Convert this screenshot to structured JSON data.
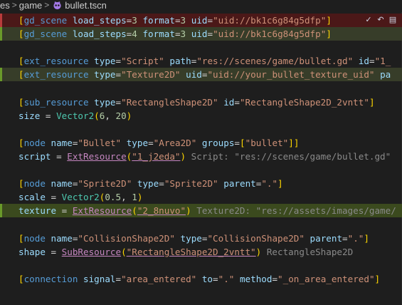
{
  "breadcrumb": {
    "items": [
      "es",
      "game",
      "bullet.tscn"
    ]
  },
  "actions": [
    "accept-check-icon",
    "undo-icon",
    "file-icon"
  ],
  "colors": {
    "background": "#1e1e1e",
    "removed_line": "#4b1818",
    "added_line": "#373d29"
  },
  "lines": [
    {
      "kind": "removed",
      "segments": [
        [
          "br",
          "["
        ],
        [
          "tag",
          "gd_scene "
        ],
        [
          "prop",
          "load_steps"
        ],
        [
          "pl",
          "="
        ],
        [
          "num",
          "3"
        ],
        [
          "pl",
          " "
        ],
        [
          "prop",
          "format"
        ],
        [
          "pl",
          "="
        ],
        [
          "num",
          "3"
        ],
        [
          "pl",
          " "
        ],
        [
          "prop",
          "uid"
        ],
        [
          "pl",
          "="
        ],
        [
          "str",
          "\"uid://bk1c6g84g5dfp\""
        ],
        [
          "br",
          "]"
        ]
      ]
    },
    {
      "kind": "added",
      "segments": [
        [
          "br",
          "["
        ],
        [
          "tag",
          "gd_scene "
        ],
        [
          "prop",
          "load_steps"
        ],
        [
          "pl",
          "="
        ],
        [
          "num",
          "4"
        ],
        [
          "pl",
          " "
        ],
        [
          "prop",
          "format"
        ],
        [
          "pl",
          "="
        ],
        [
          "num",
          "3"
        ],
        [
          "pl",
          " "
        ],
        [
          "prop",
          "uid"
        ],
        [
          "pl",
          "="
        ],
        [
          "str",
          "\"uid://bk1c6g84g5dfp\""
        ],
        [
          "br",
          "]"
        ]
      ]
    },
    {
      "kind": "blank",
      "segments": []
    },
    {
      "kind": "normal",
      "segments": [
        [
          "br",
          "["
        ],
        [
          "tag",
          "ext_resource "
        ],
        [
          "prop",
          "type"
        ],
        [
          "pl",
          "="
        ],
        [
          "str",
          "\"Script\""
        ],
        [
          "pl",
          " "
        ],
        [
          "prop",
          "path"
        ],
        [
          "pl",
          "="
        ],
        [
          "str",
          "\"res://scenes/game/bullet.gd\""
        ],
        [
          "pl",
          " "
        ],
        [
          "prop",
          "id"
        ],
        [
          "pl",
          "="
        ],
        [
          "str",
          "\"1_"
        ]
      ]
    },
    {
      "kind": "added",
      "segments": [
        [
          "br",
          "["
        ],
        [
          "tag",
          "ext_resource "
        ],
        [
          "prop",
          "type"
        ],
        [
          "pl",
          "="
        ],
        [
          "str",
          "\"Texture2D\""
        ],
        [
          "pl",
          " "
        ],
        [
          "prop",
          "uid"
        ],
        [
          "pl",
          "="
        ],
        [
          "str",
          "\"uid://your_bullet_texture_uid\""
        ],
        [
          "pl",
          " "
        ],
        [
          "prop",
          "pa"
        ]
      ]
    },
    {
      "kind": "blank",
      "segments": []
    },
    {
      "kind": "normal",
      "segments": [
        [
          "br",
          "["
        ],
        [
          "tag",
          "sub_resource "
        ],
        [
          "prop",
          "type"
        ],
        [
          "pl",
          "="
        ],
        [
          "str",
          "\"RectangleShape2D\""
        ],
        [
          "pl",
          " "
        ],
        [
          "prop",
          "id"
        ],
        [
          "pl",
          "="
        ],
        [
          "str",
          "\"RectangleShape2D_2vntt\""
        ],
        [
          "br",
          "]"
        ]
      ]
    },
    {
      "kind": "normal",
      "segments": [
        [
          "prop",
          "size"
        ],
        [
          "pl",
          " = "
        ],
        [
          "fn",
          "Vector2"
        ],
        [
          "br",
          "("
        ],
        [
          "num",
          "6"
        ],
        [
          "pl",
          ", "
        ],
        [
          "num",
          "20"
        ],
        [
          "br",
          ")"
        ]
      ]
    },
    {
      "kind": "blank",
      "segments": []
    },
    {
      "kind": "normal",
      "segments": [
        [
          "br",
          "["
        ],
        [
          "tag",
          "node "
        ],
        [
          "prop",
          "name"
        ],
        [
          "pl",
          "="
        ],
        [
          "str",
          "\"Bullet\""
        ],
        [
          "pl",
          " "
        ],
        [
          "prop",
          "type"
        ],
        [
          "pl",
          "="
        ],
        [
          "str",
          "\"Area2D\""
        ],
        [
          "pl",
          " "
        ],
        [
          "prop",
          "groups"
        ],
        [
          "pl",
          "="
        ],
        [
          "br",
          "["
        ],
        [
          "str",
          "\"bullet\""
        ],
        [
          "br",
          "]]"
        ]
      ]
    },
    {
      "kind": "normal",
      "segments": [
        [
          "prop",
          "script"
        ],
        [
          "pl",
          " = "
        ],
        [
          "extu",
          "ExtResource"
        ],
        [
          "br",
          "("
        ],
        [
          "stru",
          "\"1_j2eda\""
        ],
        [
          "br",
          ")"
        ],
        [
          "hint",
          " Script: \"res://scenes/game/bullet.gd\""
        ]
      ]
    },
    {
      "kind": "blank",
      "segments": []
    },
    {
      "kind": "normal",
      "segments": [
        [
          "br",
          "["
        ],
        [
          "tag",
          "node "
        ],
        [
          "prop",
          "name"
        ],
        [
          "pl",
          "="
        ],
        [
          "str",
          "\"Sprite2D\""
        ],
        [
          "pl",
          " "
        ],
        [
          "prop",
          "type"
        ],
        [
          "pl",
          "="
        ],
        [
          "str",
          "\"Sprite2D\""
        ],
        [
          "pl",
          " "
        ],
        [
          "prop",
          "parent"
        ],
        [
          "pl",
          "="
        ],
        [
          "str",
          "\".\""
        ],
        [
          "br",
          "]"
        ]
      ]
    },
    {
      "kind": "normal",
      "segments": [
        [
          "prop",
          "scale"
        ],
        [
          "pl",
          " = "
        ],
        [
          "fn",
          "Vector2"
        ],
        [
          "br",
          "("
        ],
        [
          "num",
          "0.5"
        ],
        [
          "pl",
          ", "
        ],
        [
          "num",
          "1"
        ],
        [
          "br",
          ")"
        ]
      ]
    },
    {
      "kind": "added-strong",
      "segments": [
        [
          "prop",
          "texture"
        ],
        [
          "pl",
          " = "
        ],
        [
          "extu",
          "ExtResource"
        ],
        [
          "br",
          "("
        ],
        [
          "stru",
          "\"2_8nuvo\""
        ],
        [
          "br",
          ")"
        ],
        [
          "hint",
          " Texture2D: \"res://assets/images/game/"
        ]
      ]
    },
    {
      "kind": "blank",
      "segments": []
    },
    {
      "kind": "normal",
      "segments": [
        [
          "br",
          "["
        ],
        [
          "tag",
          "node "
        ],
        [
          "prop",
          "name"
        ],
        [
          "pl",
          "="
        ],
        [
          "str",
          "\"CollisionShape2D\""
        ],
        [
          "pl",
          " "
        ],
        [
          "prop",
          "type"
        ],
        [
          "pl",
          "="
        ],
        [
          "str",
          "\"CollisionShape2D\""
        ],
        [
          "pl",
          " "
        ],
        [
          "prop",
          "parent"
        ],
        [
          "pl",
          "="
        ],
        [
          "str",
          "\".\""
        ],
        [
          "br",
          "]"
        ]
      ]
    },
    {
      "kind": "normal",
      "segments": [
        [
          "prop",
          "shape"
        ],
        [
          "pl",
          " = "
        ],
        [
          "extu",
          "SubResource"
        ],
        [
          "br",
          "("
        ],
        [
          "stru",
          "\"RectangleShape2D_2vntt\""
        ],
        [
          "br",
          ")"
        ],
        [
          "hint",
          " RectangleShape2D"
        ]
      ]
    },
    {
      "kind": "blank",
      "segments": []
    },
    {
      "kind": "normal",
      "segments": [
        [
          "br",
          "["
        ],
        [
          "tag",
          "connection "
        ],
        [
          "prop",
          "signal"
        ],
        [
          "pl",
          "="
        ],
        [
          "str",
          "\"area_entered\""
        ],
        [
          "pl",
          " "
        ],
        [
          "prop",
          "to"
        ],
        [
          "pl",
          "="
        ],
        [
          "str",
          "\".\""
        ],
        [
          "pl",
          " "
        ],
        [
          "prop",
          "method"
        ],
        [
          "pl",
          "="
        ],
        [
          "str",
          "\"_on_area_entered\""
        ],
        [
          "br",
          "]"
        ]
      ]
    }
  ]
}
